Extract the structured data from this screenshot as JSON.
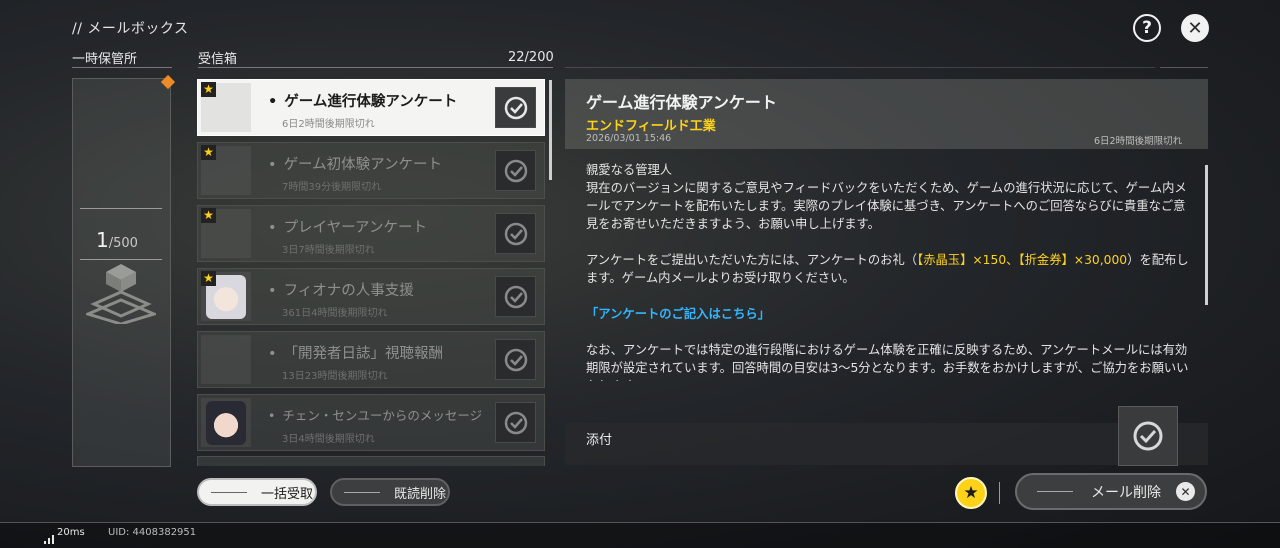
{
  "header": {
    "title": "// メールボックス"
  },
  "storage": {
    "label": "一時保管所",
    "count": "1",
    "max": "500"
  },
  "inbox": {
    "label": "受信箱",
    "count": "22/200",
    "items": [
      {
        "title": "ゲーム進行体験アンケート",
        "sub": "6日2時間後期限切れ",
        "starred": true,
        "selected": true
      },
      {
        "title": "ゲーム初体験アンケート",
        "sub": "7時間39分後期限切れ",
        "starred": true,
        "selected": false
      },
      {
        "title": "プレイヤーアンケート",
        "sub": "3日7時間後期限切れ",
        "starred": true,
        "selected": false
      },
      {
        "title": "フィオナの人事支援",
        "sub": "361日4時間後期限切れ",
        "starred": true,
        "selected": false
      },
      {
        "title": "「開発者日誌」視聴報酬",
        "sub": "13日23時間後期限切れ",
        "starred": false,
        "selected": false
      },
      {
        "title": "チェン・センユーからのメッセージ",
        "sub": "3日4時間後期限切れ",
        "starred": false,
        "selected": false
      }
    ],
    "receive_all": "一括受取",
    "delete_read": "既読削除"
  },
  "detail": {
    "title": "ゲーム進行体験アンケート",
    "sender": "エンドフィールド工業",
    "date": "2026/03/01 15:46",
    "expiry": "6日2時間後期限切れ",
    "greeting": "親愛なる管理人",
    "para1": "現在のバージョンに関するご意見やフィードバックをいただくため、ゲームの進行状況に応じて、ゲーム内メールでアンケートを配布いたします。実際のプレイ体験に基づき、アンケートへのご回答ならびに貴重なご意見をお寄せいただきますよう、お願い申し上げます。",
    "para2_a": "アンケートをご提出いただいた方には、アンケートのお礼（",
    "reward1": "【赤晶玉】×150",
    "para2_sep": "、",
    "reward2": "【折金券】×30,000",
    "para2_b": "）を配布します。ゲーム内メールよりお受け取りください。",
    "link": "「アンケートのご記入はこちら」",
    "para3": "なお、アンケートでは特定の進行段階におけるゲーム体験を正確に反映するため、アンケートメールには有効期限が設定されています。回答時間の目安は3〜5分となります。お手数をおかけしますが、ご協力をお願いいたします。",
    "attach_label": "添付"
  },
  "actions": {
    "mail_delete": "メール削除"
  },
  "status": {
    "ping": "20ms",
    "uid": "UID: 4408382951"
  }
}
